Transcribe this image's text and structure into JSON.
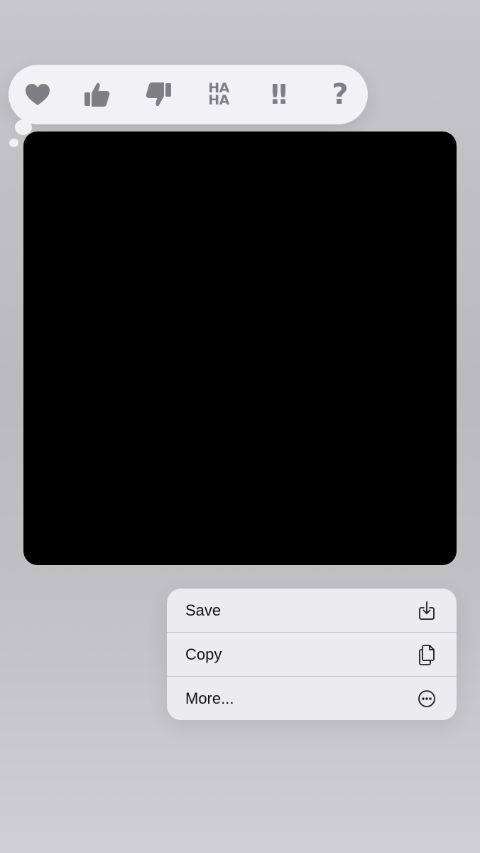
{
  "tapback": {
    "reactions": [
      {
        "name": "heart",
        "icon": "heart-icon"
      },
      {
        "name": "thumbs-up",
        "icon": "thumbs-up-icon"
      },
      {
        "name": "thumbs-down",
        "icon": "thumbs-down-icon"
      },
      {
        "name": "haha",
        "icon": "haha-icon",
        "text_line1": "HA",
        "text_line2": "HA"
      },
      {
        "name": "emphasize",
        "icon": "double-exclamation-icon",
        "text": "!!"
      },
      {
        "name": "question",
        "icon": "question-mark-icon",
        "text": "?"
      }
    ],
    "icon_color": "#7e7e84",
    "bar_color": "#f2f2f4"
  },
  "media": {
    "background": "#000000"
  },
  "context_menu": {
    "items": [
      {
        "label": "Save",
        "icon": "save-download-icon"
      },
      {
        "label": "Copy",
        "icon": "copy-documents-icon"
      },
      {
        "label": "More...",
        "icon": "more-ellipsis-circle-icon"
      }
    ]
  }
}
